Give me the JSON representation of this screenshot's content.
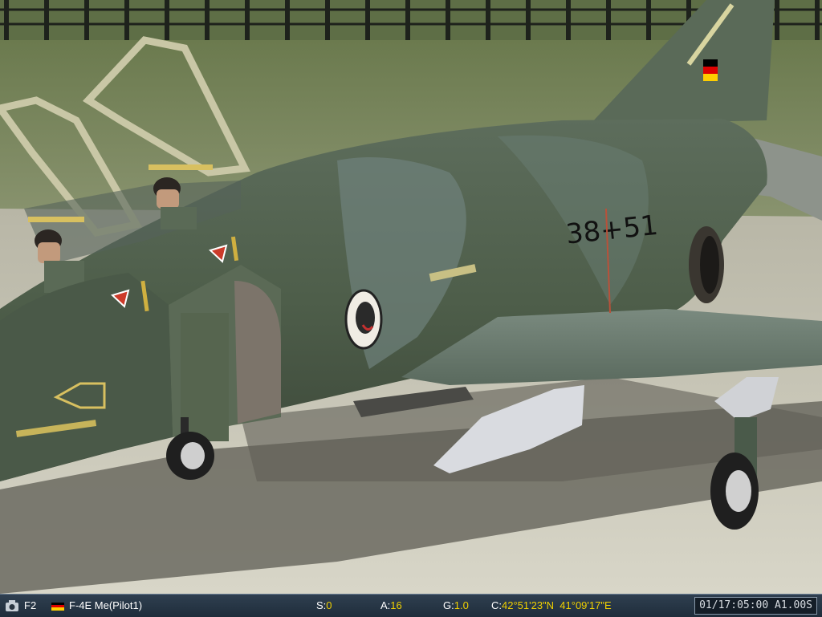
{
  "scene": {
    "aircraft_serial": "38+51"
  },
  "statusbar": {
    "view_key": "F2",
    "aircraft_label": "F-4E Me(Pilot1)",
    "speed_label": "S:",
    "speed_value": "0",
    "altitude_label": "A:",
    "altitude_value": "16",
    "g_label": "G:",
    "g_value": "1.0",
    "coords_label": "C:",
    "coords_value": "42°51'23\"N  41°09'17\"E",
    "clock": "01/17:05:00 A1.00S"
  },
  "icons": {
    "camera": "camera-icon",
    "flag": "germany-flag-icon"
  },
  "colors": {
    "statusbar_bg": "#263646",
    "value_yellow": "#f0d000",
    "flag_black": "#000000",
    "flag_red": "#dd0000",
    "flag_gold": "#ffce00"
  }
}
